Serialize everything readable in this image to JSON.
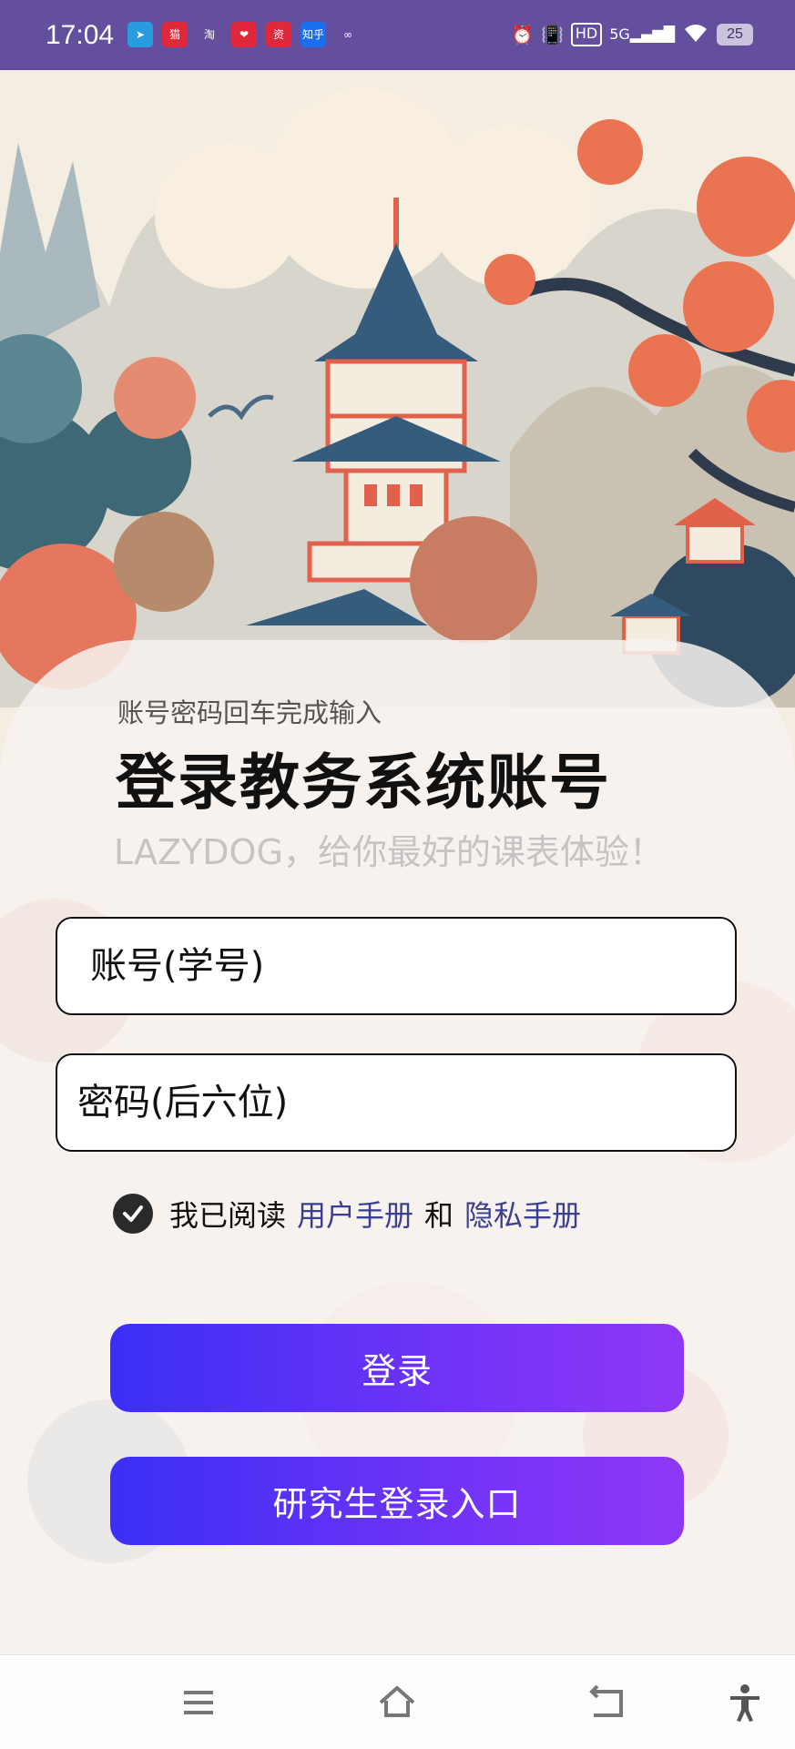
{
  "status_bar": {
    "time": "17:04",
    "notifications": [
      {
        "name": "telegram-icon",
        "glyph": "➤",
        "color": "#2b9be0"
      },
      {
        "name": "tmall-icon",
        "glyph": "猫",
        "color": "#e0283a"
      },
      {
        "name": "taobao-icon",
        "glyph": "淘",
        "color": "#634f9e"
      },
      {
        "name": "app-red-icon",
        "glyph": "❤",
        "color": "#e0283a"
      },
      {
        "name": "app-news-icon",
        "glyph": "资",
        "color": "#e0283a"
      },
      {
        "name": "zhihu-icon",
        "glyph": "知乎",
        "color": "#1a6ef0"
      },
      {
        "name": "app-link-icon",
        "glyph": "∞",
        "color": "#634f9e"
      }
    ],
    "network": "5G",
    "hd": "HD",
    "battery": "25"
  },
  "login": {
    "subtitle": "账号密码回车完成输入",
    "title": "登录教务系统账号",
    "slogan": "LAZYDOG，给你最好的课表体验！",
    "account_placeholder": "账号(学号)",
    "password_placeholder": "密码(后六位)",
    "agree_prefix": "我已阅读",
    "user_manual": "用户手册",
    "agree_and": "和",
    "privacy_manual": "隐私手册",
    "agreed": true,
    "login_button": "登录",
    "graduate_button": "研究生登录入口"
  },
  "nav_bar": {
    "menu": "menu-icon",
    "home": "home-icon",
    "back": "back-icon",
    "accessibility": "accessibility-icon"
  }
}
